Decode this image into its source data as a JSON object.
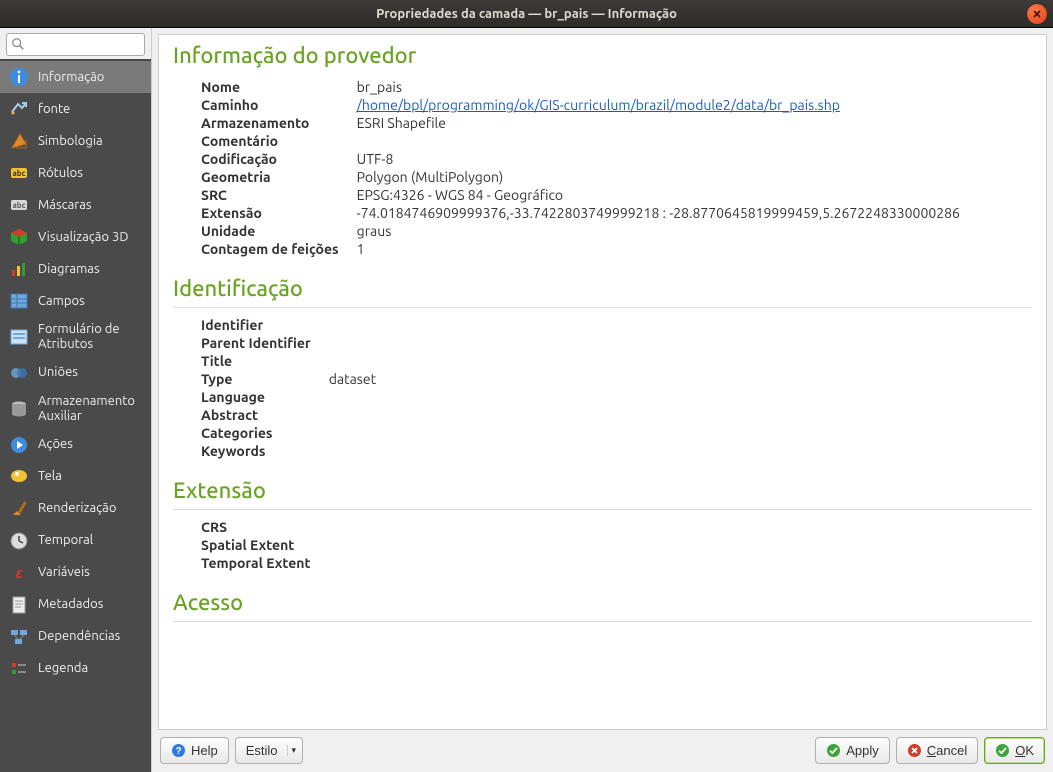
{
  "window": {
    "title": "Propriedades da camada — br_pais — Informação"
  },
  "search": {
    "placeholder": ""
  },
  "sidebar": {
    "items": [
      {
        "label": "Informação",
        "icon": "info"
      },
      {
        "label": "fonte",
        "icon": "source"
      },
      {
        "label": "Simbologia",
        "icon": "symbology"
      },
      {
        "label": "Rótulos",
        "icon": "labels"
      },
      {
        "label": "Máscaras",
        "icon": "masks"
      },
      {
        "label": "Visualização 3D",
        "icon": "view3d"
      },
      {
        "label": "Diagramas",
        "icon": "diagrams"
      },
      {
        "label": "Campos",
        "icon": "fields"
      },
      {
        "label": "Formulário de Atributos",
        "icon": "attrform"
      },
      {
        "label": "Uniões",
        "icon": "joins"
      },
      {
        "label": "Armazenamento Auxiliar",
        "icon": "auxstorage"
      },
      {
        "label": "Ações",
        "icon": "actions"
      },
      {
        "label": "Tela",
        "icon": "display"
      },
      {
        "label": "Renderização",
        "icon": "rendering"
      },
      {
        "label": "Temporal",
        "icon": "temporal"
      },
      {
        "label": "Variáveis",
        "icon": "variables"
      },
      {
        "label": "Metadados",
        "icon": "metadata"
      },
      {
        "label": "Dependências",
        "icon": "dependencies"
      },
      {
        "label": "Legenda",
        "icon": "legend"
      }
    ]
  },
  "sections": {
    "provider": {
      "heading": "Informação do provedor",
      "rows": [
        {
          "k": "Nome",
          "v": "br_pais"
        },
        {
          "k": "Caminho",
          "v": "/home/bpl/programming/ok/GIS-curriculum/brazil/module2/data/br_pais.shp",
          "link": true
        },
        {
          "k": "Armazenamento",
          "v": "ESRI Shapefile"
        },
        {
          "k": "Comentário",
          "v": ""
        },
        {
          "k": "Codificação",
          "v": "UTF-8"
        },
        {
          "k": "Geometria",
          "v": "Polygon (MultiPolygon)"
        },
        {
          "k": "SRC",
          "v": "EPSG:4326 - WGS 84 - Geográfico"
        },
        {
          "k": "Extensão",
          "v": "-74.0184746909999376,-33.7422803749999218 : -28.8770645819999459,5.2672248330000286"
        },
        {
          "k": "Unidade",
          "v": "graus"
        },
        {
          "k": "Contagem de feições",
          "v": "1"
        }
      ]
    },
    "identification": {
      "heading": "Identificação",
      "rows": [
        {
          "k": "Identifier",
          "v": ""
        },
        {
          "k": "Parent Identifier",
          "v": ""
        },
        {
          "k": "Title",
          "v": ""
        },
        {
          "k": "Type",
          "v": "dataset"
        },
        {
          "k": "Language",
          "v": ""
        },
        {
          "k": "Abstract",
          "v": ""
        },
        {
          "k": "Categories",
          "v": ""
        },
        {
          "k": "Keywords",
          "v": ""
        }
      ]
    },
    "extent": {
      "heading": "Extensão",
      "rows": [
        {
          "k": "CRS",
          "v": ""
        },
        {
          "k": "Spatial Extent",
          "v": ""
        },
        {
          "k": "Temporal Extent",
          "v": ""
        }
      ]
    },
    "access": {
      "heading": "Acesso"
    }
  },
  "buttons": {
    "help": "Help",
    "style": "Estilo",
    "apply": "Apply",
    "cancel": "Cancel",
    "ok": "OK"
  }
}
